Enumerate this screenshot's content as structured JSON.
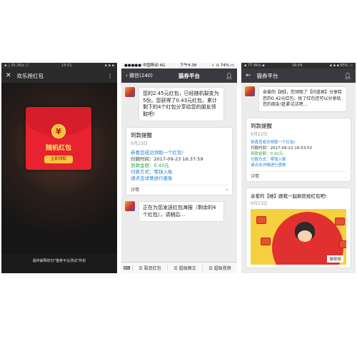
{
  "panel1": {
    "status": {
      "left": "▪ ▯ 35.3K/s ☐",
      "center": "15:51",
      "right": "▪ ▪ ▪"
    },
    "title": "欢乐抢红包",
    "envelope": {
      "coin_symbol": "¥",
      "title": "随机红包",
      "button": "立即领取"
    },
    "footer": "最终解释权归\"猫券平台测试\"所有"
  },
  "panel2": {
    "status": {
      "left": "●●●●● 中国移动 4G",
      "center": "下午4:38",
      "right": "✓ ⊙ 74% ▭"
    },
    "back_label": "微信(240)",
    "title": "猫券平台",
    "msg1": "您的2.45元红包，已经随机裂变为5份。您获得了0.43元红包，累计剩下的4个红包分享给您的朋友领取吧!",
    "card": {
      "title": "到款提醒",
      "date": "9月23日",
      "lines": [
        "恭喜您成功领取一个红包!",
        "付款时间：2017-09-23 16:37:59",
        "到款金额：0.43元",
        "付款方式：零钱入账",
        "请点击详情进行查账"
      ],
      "detail": "详情"
    },
    "msg2": "正在为您发送红包海报（剩余的4个红包），请稍后…",
    "menu": [
      "☰ 裂变红包",
      "☰ 超级图文",
      "☰ 超级视频"
    ]
  },
  "panel3": {
    "status": {
      "left": "▪ 77.4K/s ▪",
      "center": "16:54",
      "right": "▪ ▪ ▪ 85% ▭"
    },
    "title": "猫券平台",
    "msg1": "亲爱的【她】，您领取了【问道君】分享给您的0.42元红包，抢了红包还可以分享给您的朋友!赶紧试试吧…",
    "card": {
      "title": "到款提醒",
      "date": "9月22日",
      "lines": [
        "恭喜您成功领取一个红包!",
        "付款时间：2017-09-22 16:53:53",
        "到款金额：0.42元",
        "付款方式：零钱入账",
        "请点击详情进行查账"
      ],
      "detail": "详情"
    },
    "poster": {
      "title": "亲爱的【她】跟我一起疯狂抢红包吧!",
      "date": "9月23日",
      "tag": "猫视频"
    }
  }
}
